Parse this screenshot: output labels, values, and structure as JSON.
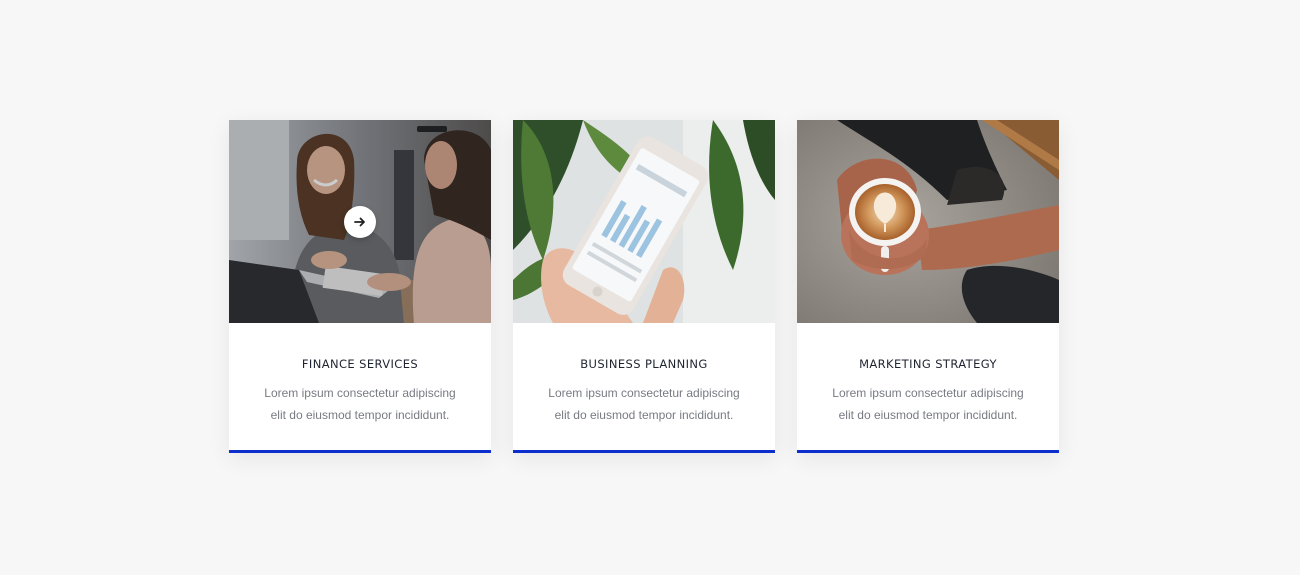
{
  "theme": {
    "accent": "#0b2ecc",
    "background": "#f7f7f7"
  },
  "cards": [
    {
      "title": "FINANCE SERVICES",
      "text_line1": "Lorem ipsum consectetur adipiscing",
      "text_line2": "elit do eiusmod tempor incididunt.",
      "image": "photo-two-women-laptop",
      "hover_icon": "arrow-right-icon"
    },
    {
      "title": "BUSINESS PLANNING",
      "text_line1": "Lorem ipsum consectetur adipiscing",
      "text_line2": "elit do eiusmod tempor incididunt.",
      "image": "photo-phone-analytics"
    },
    {
      "title": "MARKETING STRATEGY",
      "text_line1": "Lorem ipsum consectetur adipiscing",
      "text_line2": "elit do eiusmod tempor incididunt.",
      "image": "photo-coffee-latte-art"
    }
  ]
}
